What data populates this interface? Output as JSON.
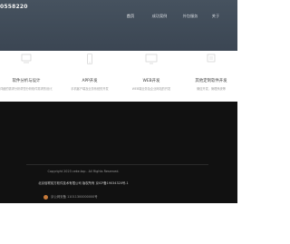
{
  "site": {
    "brand": "0558220"
  },
  "nav": [
    {
      "label": "首页",
      "active": true
    },
    {
      "label": "成功案例",
      "active": false
    },
    {
      "label": "外包服务",
      "active": false
    },
    {
      "label": "关于",
      "active": false
    }
  ],
  "features": [
    {
      "icon": "design-icon",
      "title": "软件分析与设计",
      "desc": "详细的需求分析帮您分析软件需求的设计方案"
    },
    {
      "icon": "mobile-icon",
      "title": "APP开发",
      "desc": "手机客户端及业务系统的开发"
    },
    {
      "icon": "monitor-icon",
      "title": "WEB开发",
      "desc": "WEB端业务及企业网站的开发"
    },
    {
      "icon": "custom-icon",
      "title": "其他定制软件开发",
      "desc": "微信开发、管理系统等"
    }
  ],
  "footer": {
    "copyright": "Copyright 2023 ceke.top . All Rights Reserved.",
    "company": "北京佰联前方软件技术有限公司   版权所有   京ICP备19034320号-1",
    "police": "京公网安备 11011300000000号"
  },
  "colors": {
    "hero_bg": "#46525f",
    "footer_bg": "#111111",
    "icon_stroke": "#c8c8c8",
    "badge": "#c77a3a"
  }
}
